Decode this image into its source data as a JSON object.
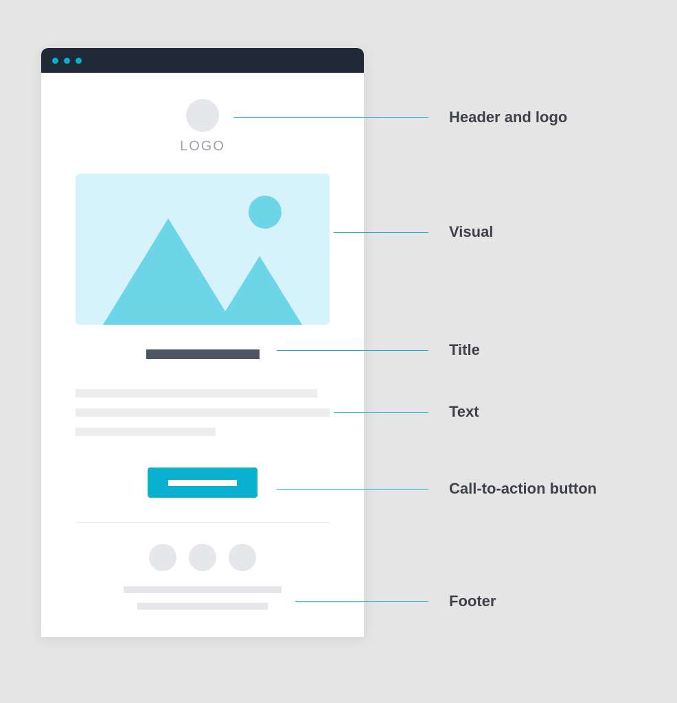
{
  "wireframe": {
    "logo_label": "LOGO"
  },
  "annotations": {
    "header": "Header and logo",
    "visual": "Visual",
    "title": "Title",
    "text": "Text",
    "cta": "Call-to-action button",
    "footer": "Footer"
  }
}
